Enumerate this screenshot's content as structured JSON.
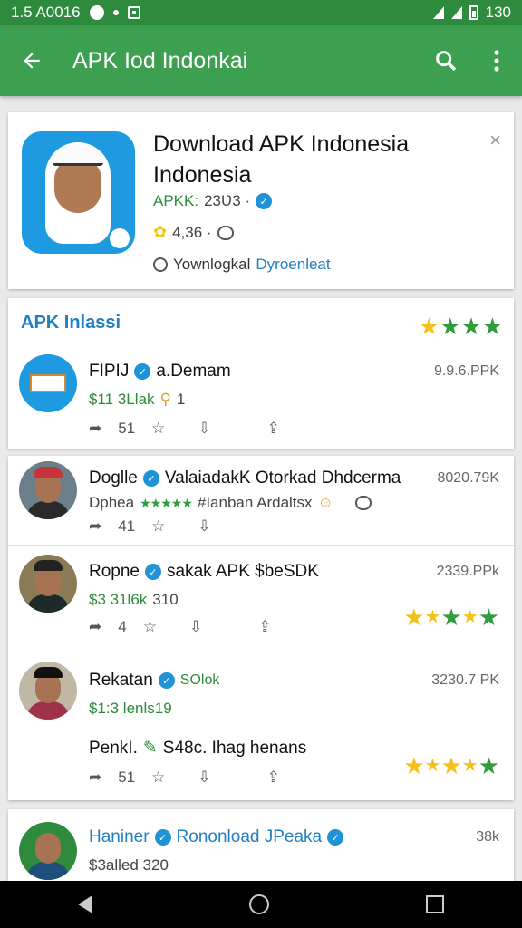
{
  "status_bar": {
    "time": "1.5 A0016",
    "right_time": "130"
  },
  "app_bar": {
    "title": "APK Iod Indonkai",
    "back_icon": "arrow-left-icon",
    "search_icon": "search-icon",
    "menu_icon": "more-vert-icon"
  },
  "featured": {
    "title": "Download APK Indonesia Indonesia",
    "meta1_label": "APKK:",
    "meta1_value": "23Ʋ3 ·",
    "meta2_value": "4,36 ·",
    "meta3_label": "Yownlogkal",
    "meta3_link": "Dyroenleat",
    "close": "×"
  },
  "section": {
    "title": "APK Inlassi",
    "item": {
      "name": "FIPIJ",
      "publisher": "a.Demam",
      "size": "9.9.6.PPK",
      "price": "$11 3Llak",
      "count": "1",
      "act_count": "51"
    }
  },
  "list": [
    {
      "name": "Doglle",
      "tag": "ValaiadakK Otorkad Dhdcerma",
      "size": "8020.79K",
      "sub": "Dphea",
      "sub_rest": "#Ianban Ardaltsx",
      "act_count": "41"
    },
    {
      "name": "Ropne",
      "tag": "sakak APK $beSDK",
      "size": "2339.PPk",
      "sub": "$3 31l6k",
      "sub_rest": "310",
      "act_count": "4"
    },
    {
      "name": "Rekatan",
      "tag": "SOlok",
      "size": "3230.7 PK",
      "sub": "$1:3 lenls19",
      "sub_rest": "",
      "extra": "PenkI.",
      "extra_tag": "S48c. Ihag henans",
      "act_count": "51"
    }
  ],
  "bottom_item": {
    "name": "Haniner",
    "tag": "Rononload JPeaka",
    "size": "38k",
    "sub": "$3alled 320"
  },
  "colors": {
    "primary": "#3da050",
    "status": "#2e8b3e",
    "accent_blue": "#1f7fc2",
    "star_yellow": "#f2c21a",
    "star_green": "#2e9e3c"
  }
}
